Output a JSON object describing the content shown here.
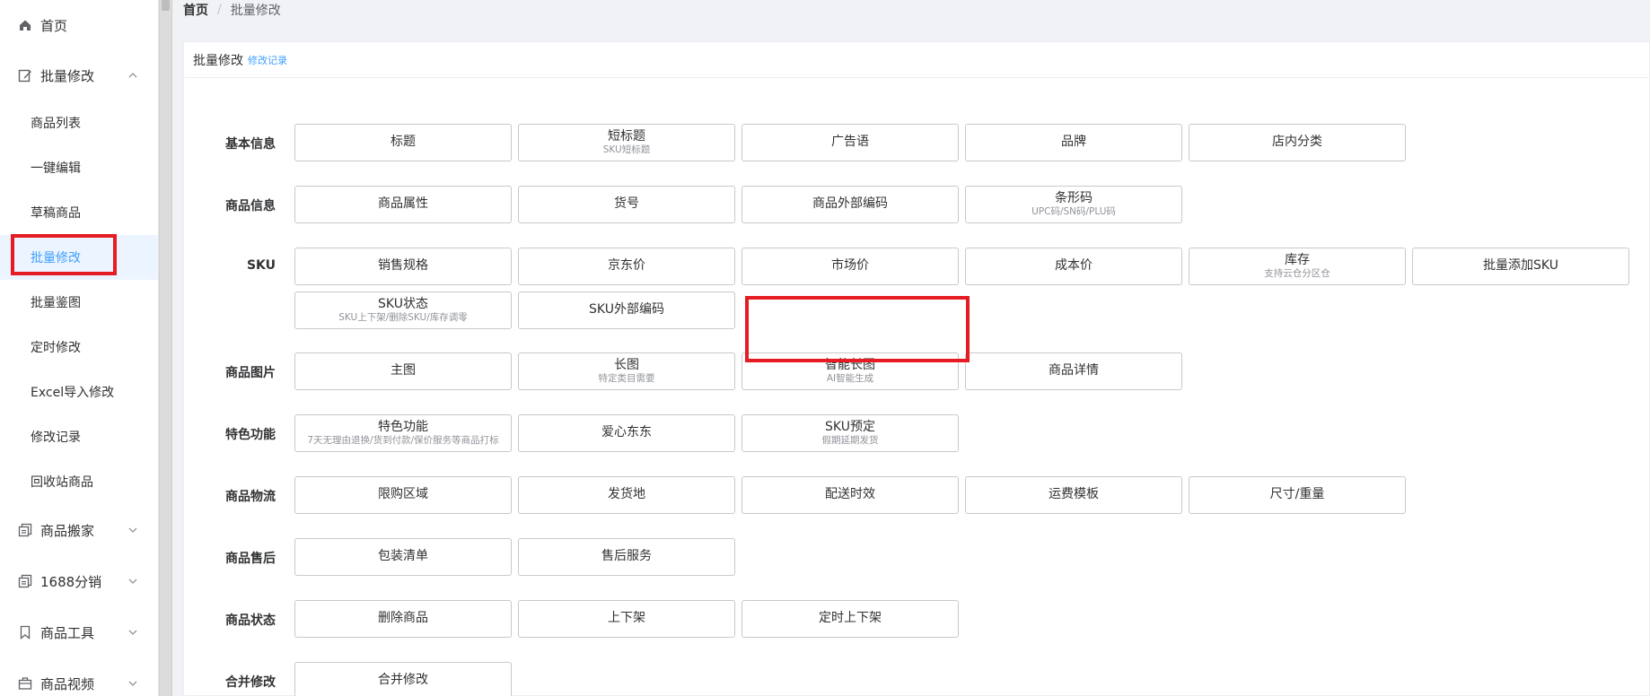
{
  "sidebar": {
    "items": [
      {
        "label": "首页",
        "icon": "home-icon"
      },
      {
        "label": "批量修改",
        "icon": "edit-icon",
        "expanded": true,
        "children": [
          "商品列表",
          "一键编辑",
          "草稿商品",
          "批量修改",
          "批量鉴图",
          "定时修改",
          "Excel导入修改",
          "修改记录",
          "回收站商品"
        ],
        "active_child": "批量修改"
      },
      {
        "label": "商品搬家",
        "icon": "copy-icon"
      },
      {
        "label": "1688分销",
        "icon": "copy-icon"
      },
      {
        "label": "商品工具",
        "icon": "bookmark-icon"
      },
      {
        "label": "商品视频",
        "icon": "briefcase-icon"
      }
    ]
  },
  "breadcrumb": {
    "home": "首页",
    "separator": "/",
    "current": "批量修改"
  },
  "card": {
    "title": "批量修改",
    "link": "修改记录"
  },
  "sections": [
    {
      "label": "基本信息",
      "buttons": [
        {
          "label": "标题"
        },
        {
          "label": "短标题",
          "sub": "SKU短标题"
        },
        {
          "label": "广告语"
        },
        {
          "label": "品牌"
        },
        {
          "label": "店内分类"
        }
      ]
    },
    {
      "label": "商品信息",
      "buttons": [
        {
          "label": "商品属性"
        },
        {
          "label": "货号"
        },
        {
          "label": "商品外部编码"
        },
        {
          "label": "条形码",
          "sub": "UPC码/SN码/PLU码"
        }
      ]
    },
    {
      "label": "SKU",
      "buttons": [
        {
          "label": "销售规格"
        },
        {
          "label": "京东价"
        },
        {
          "label": "市场价"
        },
        {
          "label": "成本价"
        },
        {
          "label": "库存",
          "sub": "支持云仓分区仓"
        },
        {
          "label": "批量添加SKU"
        },
        {
          "label": "SKU状态",
          "sub": "SKU上下架/删除SKU/库存调零"
        },
        {
          "label": "SKU外部编码"
        }
      ]
    },
    {
      "label": "商品图片",
      "buttons": [
        {
          "label": "主图"
        },
        {
          "label": "长图",
          "sub": "特定类目需要"
        },
        {
          "label": "智能长图",
          "sub": "AI智能生成"
        },
        {
          "label": "商品详情"
        }
      ]
    },
    {
      "label": "特色功能",
      "buttons": [
        {
          "label": "特色功能",
          "sub": "7天无理由退换/货到付款/保价服务等商品打标"
        },
        {
          "label": "爱心东东"
        },
        {
          "label": "SKU预定",
          "sub": "假期延期发货"
        }
      ]
    },
    {
      "label": "商品物流",
      "buttons": [
        {
          "label": "限购区域"
        },
        {
          "label": "发货地"
        },
        {
          "label": "配送时效"
        },
        {
          "label": "运费模板"
        },
        {
          "label": "尺寸/重量"
        }
      ]
    },
    {
      "label": "商品售后",
      "buttons": [
        {
          "label": "包装清单"
        },
        {
          "label": "售后服务"
        }
      ]
    },
    {
      "label": "商品状态",
      "buttons": [
        {
          "label": "删除商品"
        },
        {
          "label": "上下架"
        },
        {
          "label": "定时上下架"
        }
      ]
    },
    {
      "label": "合并修改",
      "buttons": [
        {
          "label": "合并修改"
        }
      ]
    }
  ],
  "colors": {
    "highlight": "#e51c23",
    "accent": "#409eff"
  }
}
